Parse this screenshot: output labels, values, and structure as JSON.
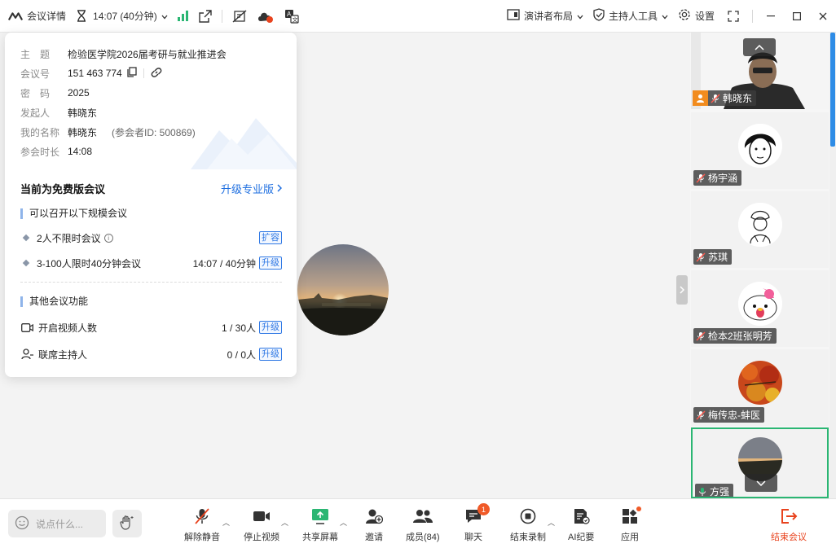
{
  "topbar": {
    "meeting_info_label": "会议详情",
    "timer_text": "14:07 (40分钟)",
    "speaker_layout_label": "演讲者布局",
    "host_tools_label": "主持人工具",
    "settings_label": "设置"
  },
  "info": {
    "rows": [
      {
        "key": "主　题",
        "value": "检验医学院2026届考研与就业推进会"
      },
      {
        "key": "会议号",
        "value": "151 463 774"
      },
      {
        "key": "密　码",
        "value": "2025"
      },
      {
        "key": "发起人",
        "value": "韩晓东"
      },
      {
        "key": "我的名称",
        "value": "韩晓东",
        "extra": "(参会者ID: 500869)"
      },
      {
        "key": "参会时长",
        "value": "14:08"
      }
    ],
    "plan_title": "当前为免费版会议",
    "upgrade_pro_label": "升级专业版",
    "scale_section": "可以召开以下规模会议",
    "scale_items": [
      {
        "label": "2人不限时会议",
        "value": "",
        "tag": "扩容"
      },
      {
        "label": "3-100人限时40分钟会议",
        "value": "14:07 / 40分钟",
        "tag": "升级"
      }
    ],
    "other_section": "其他会议功能",
    "other_items": [
      {
        "label": "开启视频人数",
        "value": "1 / 30人",
        "tag": "升级"
      },
      {
        "label": "联席主持人",
        "value": "0 / 0人",
        "tag": "升级"
      }
    ]
  },
  "participants": [
    {
      "name": "韩晓东",
      "icon": "host-icon"
    },
    {
      "name": "杨宇涵"
    },
    {
      "name": "苏琪"
    },
    {
      "name": "检本2班张明芳"
    },
    {
      "name": "梅传忠-蚌医"
    },
    {
      "name": "方强"
    }
  ],
  "bottom": {
    "chat_placeholder": "说点什么...",
    "unmute_label": "解除静音",
    "stop_video_label": "停止视频",
    "share_label": "共享屏幕",
    "invite_label": "邀请",
    "members_label": "成员(84)",
    "chat_label": "聊天",
    "chat_badge": "1",
    "end_record_label": "结束录制",
    "ai_minutes_label": "AI纪要",
    "apps_label": "应用",
    "end_meeting_label": "结束会议"
  },
  "colors": {
    "accent": "#1f6fe0",
    "danger": "#e8431e",
    "active_border": "#2bb673"
  }
}
